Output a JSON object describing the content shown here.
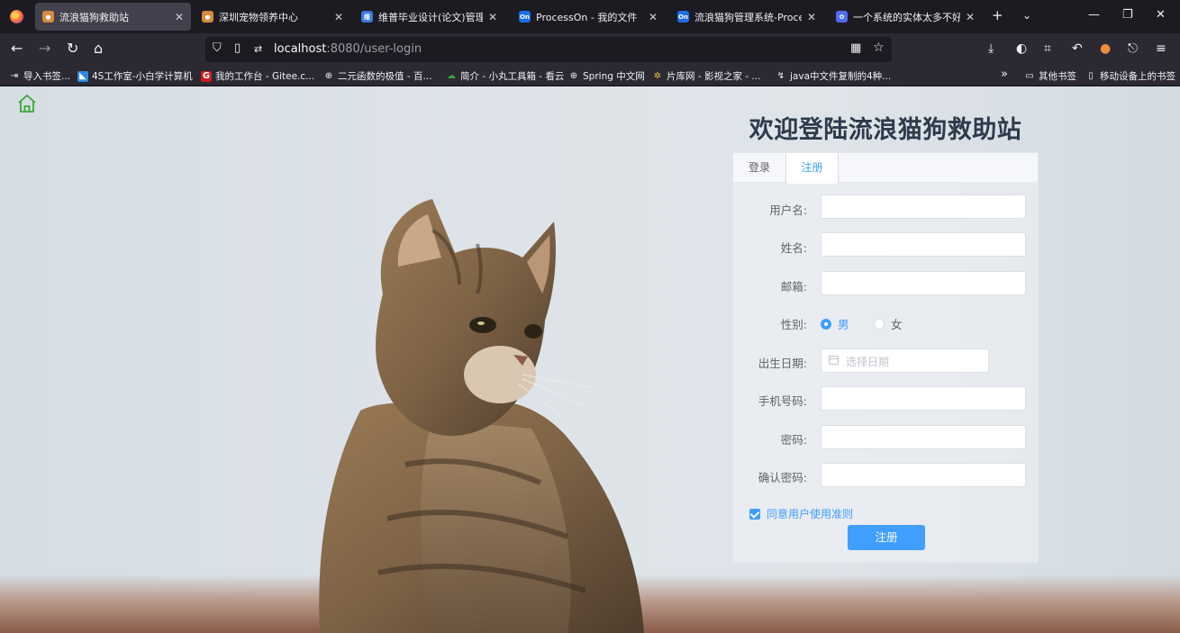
{
  "browser": {
    "tabs": [
      {
        "title": "流浪猫狗救助站",
        "active": true
      },
      {
        "title": "深圳宠物领养中心",
        "active": false
      },
      {
        "title": "维普毕业设计(论文)管理系统",
        "active": false
      },
      {
        "title": "ProcessOn - 我的文件",
        "active": false
      },
      {
        "title": "流浪猫狗管理系统-ProcessOn",
        "active": false
      },
      {
        "title": "一个系统的实体太多不好画",
        "active": false
      }
    ],
    "new_tab_label": "+",
    "url_host": "localhost",
    "url_rest": ":8080/user-login",
    "bookmarks": [
      "导入书签...",
      "4S工作室-小白学计算机",
      "我的工作台 - Gitee.c...",
      "二元函数的极值 - 百...",
      "简介 - 小丸工具箱 - 看云",
      "Spring 中文网",
      "片库网 - 影视之家 - ...",
      "java中文件复制的4种..."
    ],
    "bookmarks_overflow": "»",
    "other_bookmarks": "其他书签",
    "mobile_bookmarks": "移动设备上的书签"
  },
  "page": {
    "site_title": "欢迎登陆流浪猫狗救助站",
    "tabs": {
      "login": "登录",
      "register": "注册"
    },
    "form": {
      "username_label": "用户名:",
      "name_label": "姓名:",
      "email_label": "邮箱:",
      "gender_label": "性别:",
      "gender_male": "男",
      "gender_female": "女",
      "birth_label": "出生日期:",
      "birth_placeholder": "选择日期",
      "phone_label": "手机号码:",
      "password_label": "密码:",
      "confirm_label": "确认密码:",
      "agree_text": "同意用户使用准则",
      "submit_label": "注册"
    },
    "colors": {
      "accent": "#409eff",
      "title": "#2d3a4b",
      "home_icon": "#3aa63a"
    }
  }
}
